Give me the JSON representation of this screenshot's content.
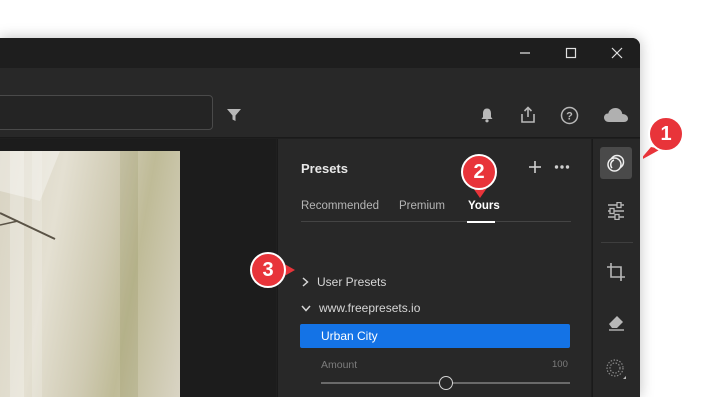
{
  "presets_panel": {
    "title": "Presets",
    "tabs": [
      {
        "label": "Recommended",
        "active": false
      },
      {
        "label": "Premium",
        "active": false
      },
      {
        "label": "Yours",
        "active": true
      }
    ],
    "groups": [
      {
        "label": "User Presets",
        "expanded": false
      },
      {
        "label": "www.freepresets.io",
        "expanded": true
      }
    ],
    "selected_preset": "Urban City",
    "amount": {
      "label": "Amount",
      "value": "100",
      "slider_fraction": 0.51
    }
  },
  "callouts": [
    "1",
    "2",
    "3"
  ],
  "icons": {
    "titlebar": [
      "minimize-icon",
      "maximize-icon",
      "close-icon"
    ],
    "toolbar": [
      "filter-icon",
      "bell-icon",
      "share-icon",
      "help-icon",
      "cloud-icon"
    ],
    "rail": [
      "presets-icon",
      "edit-sliders-icon",
      "crop-icon",
      "eraser-icon",
      "masking-icon"
    ]
  },
  "colors": {
    "accent": "#1473e6",
    "callout": "#e8343a",
    "panel_bg": "#282828"
  }
}
